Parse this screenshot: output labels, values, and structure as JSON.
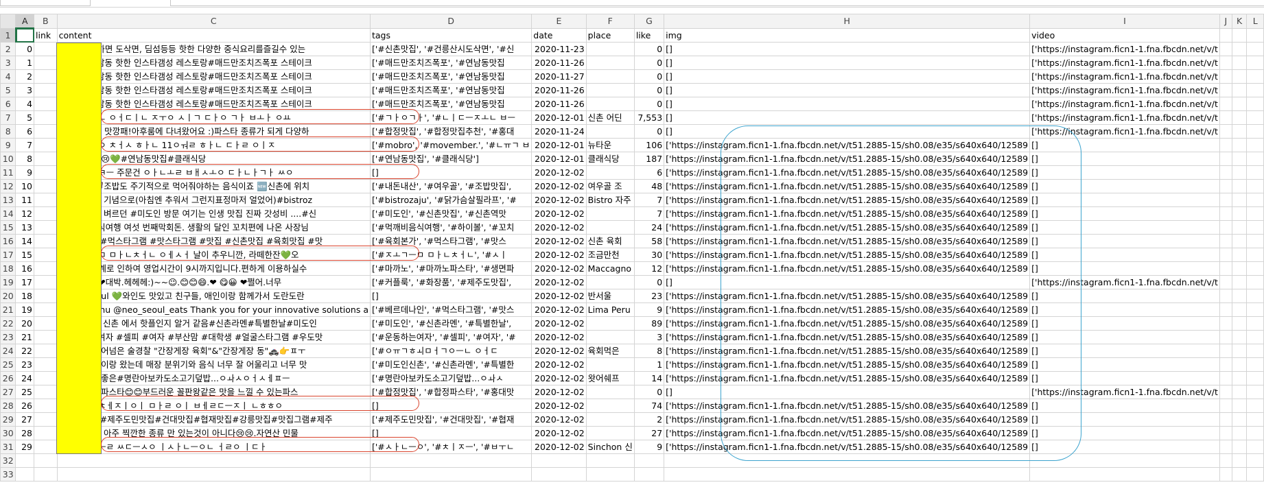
{
  "name_box": "A1",
  "columns": [
    "A",
    "B",
    "C",
    "D",
    "E",
    "F",
    "G",
    "H",
    "I",
    "J",
    "K",
    "L"
  ],
  "headers": [
    "",
    "link",
    "content",
    "tags",
    "date",
    "place",
    "like",
    "img",
    "video",
    "",
    "",
    ""
  ],
  "rows": [
    {
      "n": "2",
      "a": "0",
      "c": "(광고)중식하면 도삭면, 딤섬등등 핫한 다양한 중식요리를즐길수 있는",
      "d": "['#신촌맛집', '#건릉산시도삭면', '#신",
      "e": "2020-11-23",
      "f": "",
      "g": "0",
      "h": "[]",
      "i": "['https://instagram.ficn1-1.fna.fbcdn.net/v/t"
    },
    {
      "n": "3",
      "a": "1",
      "c": "<광고>연남동 핫한 인스타갬성 레스토랑#매드만조치즈폭포 스테이크",
      "d": "['#매드만조치즈폭포', '#연남동맛집",
      "e": "2020-11-26",
      "f": "",
      "g": "0",
      "h": "[]",
      "i": "['https://instagram.ficn1-1.fna.fbcdn.net/v/t"
    },
    {
      "n": "4",
      "a": "2",
      "c": "<광고>연남동 핫한 인스타갬성 레스토랑#매드만조치즈폭포 스테이크",
      "d": "['#매드만조치즈폭포', '#연남동맛집",
      "e": "2020-11-27",
      "f": "",
      "g": "0",
      "h": "[]",
      "i": "['https://instagram.ficn1-1.fna.fbcdn.net/v/t"
    },
    {
      "n": "5",
      "a": "3",
      "c": "<광고>연남동 핫한 인스타갬성 레스토랑#매드만조치즈폭포 스테이크",
      "d": "['#매드만조치즈폭포', '#연남동맛집",
      "e": "2020-11-26",
      "f": "",
      "g": "0",
      "h": "[]",
      "i": "['https://instagram.ficn1-1.fna.fbcdn.net/v/t"
    },
    {
      "n": "6",
      "a": "4",
      "c": "<광고>연남동 핫한 인스타갬성 레스토랑#매드만조치즈폭포 스테이크",
      "d": "['#매드만조치즈폭포', '#연남동맛집",
      "e": "2020-11-26",
      "f": "",
      "g": "0",
      "h": "[]",
      "i": "['https://instagram.ficn1-1.fna.fbcdn.net/v/t"
    },
    {
      "n": "7",
      "a": "5",
      "c": "ㅅㅣㄴㅊㅗㄴ ㅇㅓㄷㅣㄴ ㅈㅜㅇ ㅅㅣㄱ ㄷㅏㅇ ㄱㅏ ㅂㅗㅏ ㅇㅛ",
      "d": "['#ㄱㅏㅇㄱㅏ', '#ㄴㅣㄷㅡㅈㅗㄴ ㅂㅡ",
      "e": "2020-12-01",
      "f": "신촌 어딘",
      "g": "7,553",
      "h": "[]",
      "i": "['https://instagram.ficn1-1.fna.fbcdn.net/v/t"
    },
    {
      "n": "8",
      "a": "6",
      "c": "분위기깡패! 맛깡패!아후룸에 다녀왔어요 :)파스타 종류가 되게 다양하",
      "d": "['#합정맛집', '#합정맛집추천', '#홍대",
      "e": "2020-11-24",
      "f": "",
      "g": "0",
      "h": "[]",
      "i": "['https://instagram.ficn1-1.fna.fbcdn.net/v/t"
    },
    {
      "n": "9",
      "a": "7",
      "c": "ㅎㅗㄴㅅㅐㅇ ㅊㅓㅅ ㅎㅏㄴ 11ㅇㅝㄹ ㅎㅏㄴ ㄷㅏㄹ ㅇㅣㅈ",
      "d": "['#mobro', '#movember.', '#ㄴㅠㄱ ㅂ",
      "e": "2020-12-01",
      "f": "뉴타운",
      "g": "106",
      "h": "['https://instagram.ficn1-1.fna.fbcdn.net/v/t51.2885-15/sh0.08/e35/s640x640/12589",
      "i": "[]"
    },
    {
      "n": "10",
      "a": "8",
      "c": "겨울이 성큼😢💚#연남동맛집#클래식당",
      "d": "['#연남동맛집', '#클래식당']",
      "e": "2020-12-01",
      "f": "클래식당",
      "g": "187",
      "h": "['https://instagram.ficn1-1.fna.fbcdn.net/v/t51.2885-15/sh0.08/e35/s640x640/12589",
      "i": "[]"
    },
    {
      "n": "11",
      "a": "9",
      "c": "ㅇㅜㄹㅊㅣㅋㅡ 주문건 ㅇㅏㄴㅗㄹ ㅂㅐㅅㅗㅇ ㄷㅏㄴㅏㄱㅏ ㅆㅇ",
      "d": "[]",
      "e": "2020-12-02",
      "f": "",
      "g": "6",
      "h": "['https://instagram.ficn1-1.fna.fbcdn.net/v/t51.2885-15/sh0.08/e35/s640x640/12589",
      "i": "[]"
    },
    {
      "n": "12",
      "a": "10",
      "c": "🦪여우골🦪조밥도 주기적으로 먹어줘야하는 음식이죠 🆕신촌에 위치",
      "d": "['#내돈내산', '#여우골', '#조밥맛집',",
      "e": "2020-12-02",
      "f": "여우골 조",
      "g": "48",
      "h": "['https://instagram.ficn1-1.fna.fbcdn.net/v/t51.2885-15/sh0.08/e35/s640x640/12589",
      "i": "[]"
    },
    {
      "n": "13",
      "a": "11",
      "c": "일찍 퇴근한 기념으로(아침엔 추워서 그런지표정마저 얼었어)#bistroz",
      "d": "['#bistrozaju', '#닭가슴살필라프', '#",
      "e": "2020-12-02",
      "f": "Bistro 자주",
      "g": "7",
      "h": "['https://instagram.ficn1-1.fna.fbcdn.net/v/t51.2885-15/sh0.08/e35/s640x640/12589",
      "i": "[]"
    },
    {
      "n": "14",
      "a": "12",
      "c": "그간 벼르고 벼르던 #미도인 방문 여기는 인생 맛집 진짜 갓성비 ....#신",
      "d": "['#미도인', '#신촌맛집', '#신촌역맛",
      "e": "2020-12-02",
      "f": "",
      "g": "7",
      "h": "['https://instagram.ficn1-1.fna.fbcdn.net/v/t51.2885-15/sh0.08/e35/s640x640/12589",
      "i": "[]"
    },
    {
      "n": "15",
      "a": "13",
      "c": "#먹깨비음식여행 여섯 번째막회돈. 생활의 달인 꼬치편에 나온 사장님",
      "d": "['#먹깨비음식여행', '#하이볼', '#꼬치",
      "e": "2020-12-02",
      "f": "",
      "g": "24",
      "h": "['https://instagram.ficn1-1.fna.fbcdn.net/v/t51.2885-15/sh0.08/e35/s640x640/12589",
      "i": "[]"
    },
    {
      "n": "16",
      "a": "14",
      "c": "#육회본가 #먹스타그램 #맛스타그램 #맛집 #신촌맛집 #육회맛집 #맛",
      "d": "['#육회본가', '#먹스타그램', '#맛스",
      "e": "2020-12-02",
      "f": "신촌 육회",
      "g": "58",
      "h": "['https://instagram.ficn1-1.fna.fbcdn.net/v/t51.2885-15/sh0.08/e35/s640x640/12589",
      "i": "[]"
    },
    {
      "n": "17",
      "a": "15",
      "c": "ㅇㅈㅗㄱㅡㅁ ㅁㅏㄴㅊㅓㄴ ㅇㅔㅅㅓ 날이 추우니깐, 라떼한잔💚오",
      "d": "['#ㅈㅗㄱㅡㅁ ㅁㅏㄴㅊㅓㄴ', '#ㅅㅣ",
      "e": "2020-12-02",
      "f": "조금만천",
      "g": "30",
      "h": "['https://instagram.ficn1-1.fna.fbcdn.net/v/t51.2885-15/sh0.08/e35/s640x640/12589",
      "i": "[]"
    },
    {
      "n": "18",
      "a": "16",
      "c": "코로나 2단계로 인하여 영업시간이 9시까지입니다.편하게 이용하실수",
      "d": "['#마까노', '#마까노파스타', '#생면파",
      "e": "2020-12-02",
      "f": "Maccagno",
      "g": "12",
      "h": "['https://instagram.ficn1-1.fna.fbcdn.net/v/t51.2885-15/sh0.08/e35/s640x640/12589",
      "i": "[]"
    },
    {
      "n": "19",
      "a": "17",
      "c": ":).😀 ❤😋 ❤대박.헤헤헤:)~~😉.😊😊😄.❤ 😋😀 ❤쩔어.너무",
      "d": "['#커플룩', '#화장품', '#제주도맛집',",
      "e": "2020-12-02",
      "f": "",
      "g": "0",
      "h": "[]",
      "i": "['https://instagram.ficn1-1.fna.fbcdn.net/v/t"
    },
    {
      "n": "20",
      "a": "18",
      "c": "BAHN seoul 💚와인도 맛있고 친구들, 애인이랑 함께가서 도란도란",
      "d": "[]",
      "e": "2020-12-02",
      "f": "반서울",
      "g": "23",
      "h": "['https://instagram.ficn1-1.fna.fbcdn.net/v/t51.2885-15/sh0.08/e35/s640x640/12589",
      "i": "[]"
    },
    {
      "n": "21",
      "a": "19",
      "c": "Tablet Menu @neo_seoul_eats Thank you for your innovative solutions a",
      "d": "['#베르데나인', '#먹스타그램', '#맛스",
      "e": "2020-12-02",
      "f": "Lima Peru",
      "g": "9",
      "h": "['https://instagram.ficn1-1.fna.fbcdn.net/v/t51.2885-15/sh0.08/e35/s640x640/12589",
      "i": "[]"
    },
    {
      "n": "22",
      "a": "20",
      "c": "#미도인 왜 신촌 에서 핫플인지 알거 같음#신촌라멘#특별한날#미도인",
      "d": "['#미도인', '#신촌라멘', '#특별한날',",
      "e": "2020-12-02",
      "f": "",
      "g": "89",
      "h": "['https://instagram.ficn1-1.fna.fbcdn.net/v/t51.2885-15/sh0.08/e35/s640x640/12589",
      "i": "[]"
    },
    {
      "n": "23",
      "a": "21",
      "c": "#운동하는여자 #셀피 #여자 #부산맘 #대학생 #얼굴스타그램 #우도맛",
      "d": "['#운동하는여자', '#셀피', '#여자', '#",
      "e": "2020-12-02",
      "f": "",
      "g": "3",
      "h": "['https://instagram.ficn1-1.fna.fbcdn.net/v/t51.2885-15/sh0.08/e35/s640x640/12589",
      "i": "[]"
    },
    {
      "n": "24",
      "a": "22",
      "c": "밥도둑을 뛰어넘은 술경찰 \"간장게장 육회\"&\"간장게장 동\"🚓👉ㅍㅜ",
      "d": "['#ㅇㅠㄱㅎㅚㅁㅓㄱㅇㅡㄴ ㅇㅓㄷ",
      "e": "2020-12-02",
      "f": "육회먹은",
      "g": "8",
      "h": "['https://instagram.ficn1-1.fna.fbcdn.net/v/t51.2885-15/sh0.08/e35/s640x640/12589",
      "i": "[]"
    },
    {
      "n": "25",
      "a": "23",
      "c": "여기 친구들이랑 왔는데 매장 분위기와 음식 너무 잘 어울리고 너무 맛",
      "d": "['#미도인신촌', '#신촌라멘', '#특별한",
      "e": "2020-12-02",
      "f": "",
      "g": "1",
      "h": "['https://instagram.ficn1-1.fna.fbcdn.net/v/t51.2885-15/sh0.08/e35/s640x640/12589",
      "i": "[]"
    },
    {
      "n": "26",
      "a": "24",
      "c": "진짜 밸런스좋은#명란아보카도소고기덮밥...ㅇㅘㅅㅇㅓㅅㅔㅍㅡ",
      "d": "['#명란아보카도소고기덮밥...ㅇㅘㅅ",
      "e": "2020-12-02",
      "f": "왓어쉐프",
      "g": "14",
      "h": "['https://instagram.ficn1-1.fna.fbcdn.net/v/t51.2885-15/sh0.08/e35/s640x640/12589",
      "i": "[]"
    },
    {
      "n": "27",
      "a": "25",
      "c": "역대급 통닭파스타😊😊부드러운 꼴판왕같은 맛을 느낄 수 있는파스",
      "d": "['#합정맛집', '#합정파스타', '#홍대맛",
      "e": "2020-12-02",
      "f": "",
      "g": "0",
      "h": "[]",
      "i": "['https://instagram.ficn1-1.fna.fbcdn.net/v/t"
    },
    {
      "n": "28",
      "a": "26",
      "c": "ㅁㅔㅈㅗㄴㅊㅔㅈㅣㅇㅣ ㅁㅏㄹ ㅇㅣ ㅂㅔㄹㄷㅡㅈㅣ ㄴㅎㅎㅇ",
      "d": "[]",
      "e": "2020-12-02",
      "f": "",
      "g": "74",
      "h": "['https://instagram.ficn1-1.fna.fbcdn.net/v/t51.2885-15/sh0.08/e35/s640x640/12589",
      "i": "[]"
    },
    {
      "n": "29",
      "a": "27",
      "c": "dAka24zs#제주도민맛집#건대맛집#협재맛집#강릉맛집#맛집그램#제주",
      "d": "['#제주도민맛집', '#건대맛집', '#협재",
      "e": "2020-12-02",
      "f": "",
      "g": "2",
      "h": "['https://instagram.ficn1-1.fna.fbcdn.net/v/t51.2885-15/sh0.08/e35/s640x640/12589",
      "i": "[]"
    },
    {
      "n": "30",
      "a": "28",
      "c": "민물가재 는 아주 찍깐한 종류 만 있는것이 아니다😢😢.자연산 민물",
      "d": "[]",
      "e": "2020-12-02",
      "f": "",
      "g": "27",
      "h": "['https://instagram.ficn1-1.fna.fbcdn.net/v/t51.2885-15/sh0.08/e35/s640x640/12589",
      "i": "[]"
    },
    {
      "n": "31",
      "a": "29",
      "c": "ㅁㅐㄴㅓㄱㅡㄹ ㅆㄷㅡㅅㅇ ㅣㅅㅏㄴㅡㅇㄴ ㅓㄹㅇ ㅣㄷㅏ",
      "d": "['#ㅅㅏㄴㅡㅇ', '#ㅊㅣㅈㅡ', '#ㅂㅜㄴ",
      "e": "2020-12-02",
      "f": "Sinchon 신",
      "g": "9",
      "h": "['https://instagram.ficn1-1.fna.fbcdn.net/v/t51.2885-15/sh0.08/e35/s640x640/12589",
      "i": "[]"
    },
    {
      "n": "32",
      "a": "",
      "c": "",
      "d": "",
      "e": "",
      "f": "",
      "g": "",
      "h": "",
      "i": ""
    },
    {
      "n": "33",
      "a": "",
      "c": "",
      "d": "",
      "e": "",
      "f": "",
      "g": "",
      "h": "",
      "i": ""
    }
  ]
}
